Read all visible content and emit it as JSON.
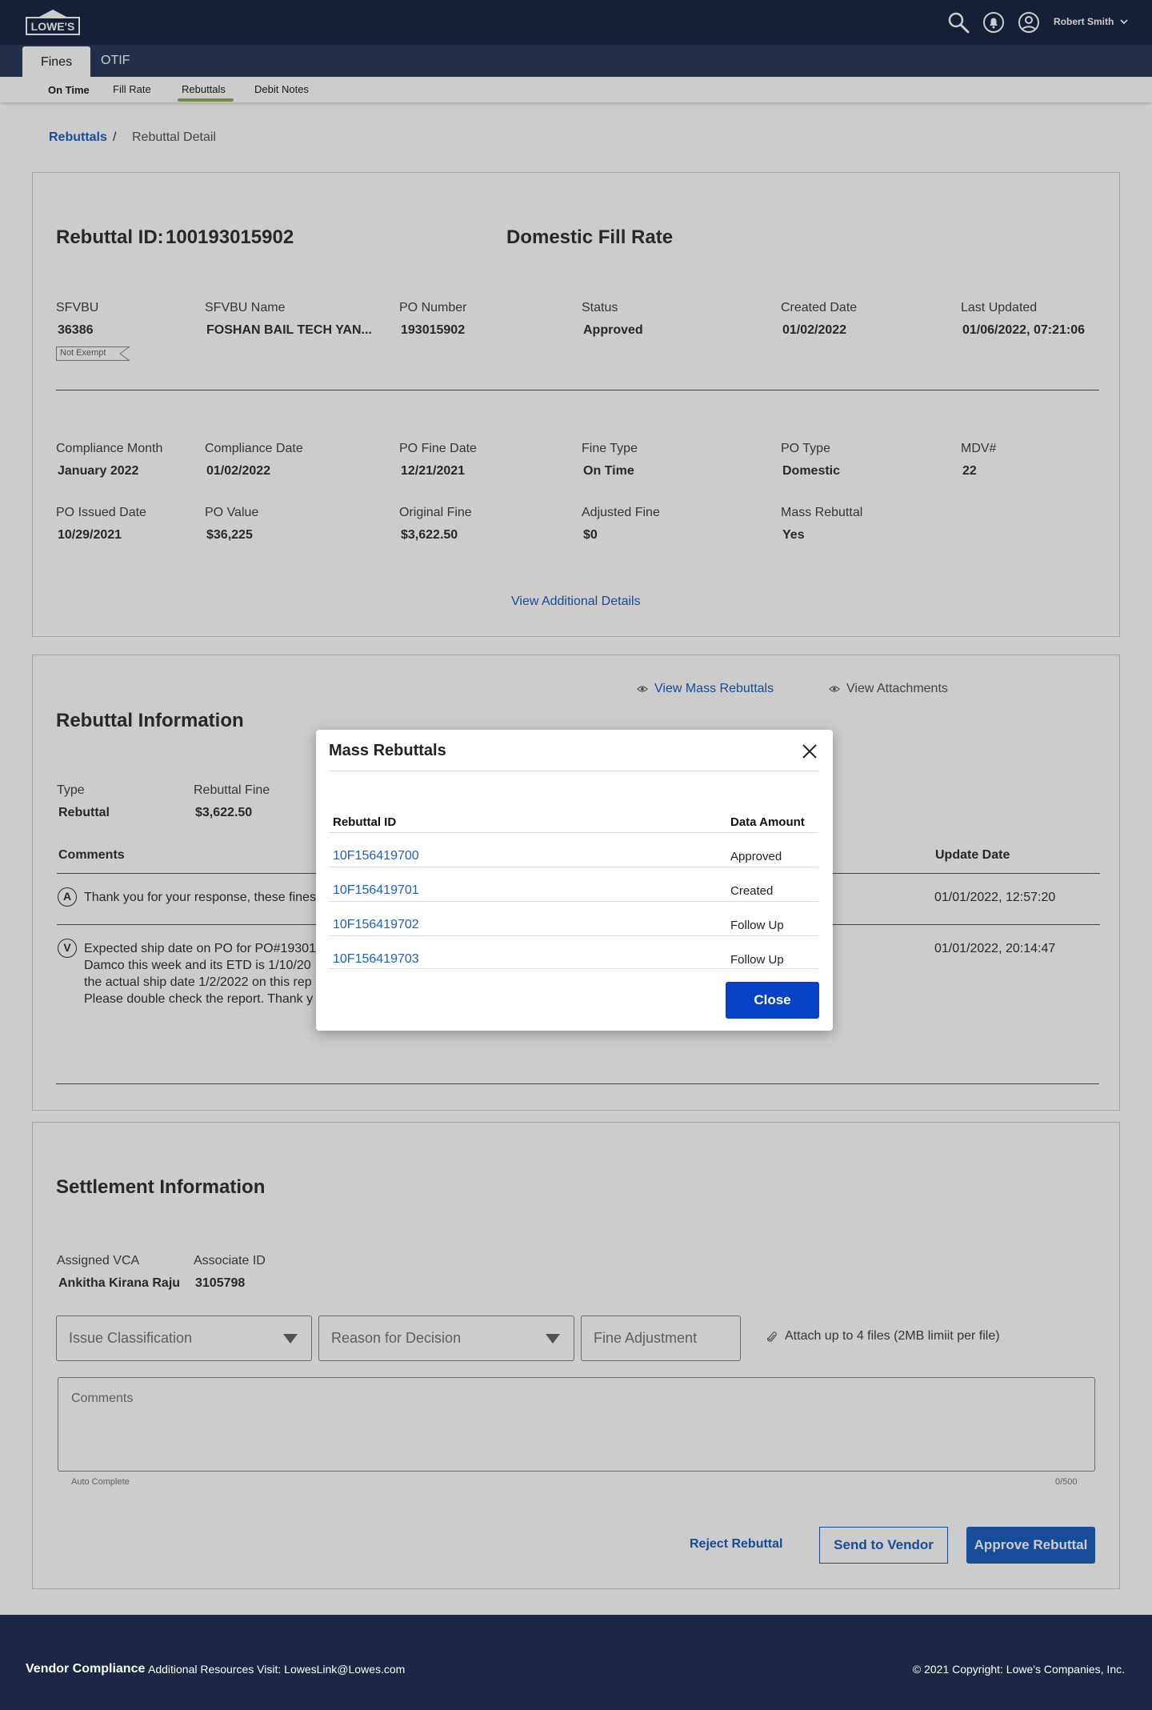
{
  "header": {
    "logo_text": "LOWE'S",
    "user_name": "Robert Smith"
  },
  "tabs": [
    {
      "label": "Fines"
    },
    {
      "label": "OTIF"
    }
  ],
  "subnav": [
    {
      "label": "On Time"
    },
    {
      "label": "Fill Rate"
    },
    {
      "label": "Rebuttals"
    },
    {
      "label": "Debit Notes"
    }
  ],
  "breadcrumb": {
    "link": "Rebuttals",
    "separator": "/",
    "current": "Rebuttal Detail"
  },
  "summary": {
    "rebuttal_id_label": "Rebuttal ID:",
    "rebuttal_id": "100193015902",
    "title": "Domestic Fill Rate",
    "exempt_badge": "Not Exempt",
    "row1": [
      {
        "label": "SFVBU",
        "value": "36386"
      },
      {
        "label": "SFVBU Name",
        "value": "FOSHAN BAIL TECH YAN..."
      },
      {
        "label": "PO Number",
        "value": "193015902"
      },
      {
        "label": "Status",
        "value": "Approved"
      },
      {
        "label": "Created Date",
        "value": "01/02/2022"
      },
      {
        "label": "Last Updated",
        "value": "01/06/2022, 07:21:06"
      }
    ],
    "row2": [
      {
        "label": "Compliance Month",
        "value": "January 2022"
      },
      {
        "label": "Compliance Date",
        "value": "01/02/2022"
      },
      {
        "label": "PO Fine Date",
        "value": "12/21/2021"
      },
      {
        "label": "Fine Type",
        "value": "On Time"
      },
      {
        "label": "PO Type",
        "value": "Domestic"
      },
      {
        "label": "MDV#",
        "value": "22"
      }
    ],
    "row3": [
      {
        "label": "PO Issued Date",
        "value": "10/29/2021"
      },
      {
        "label": "PO Value",
        "value": "$36,225"
      },
      {
        "label": "Original Fine",
        "value": "$3,622.50"
      },
      {
        "label": "Adjusted Fine",
        "value": "$0"
      },
      {
        "label": "Mass Rebuttal",
        "value": "Yes"
      }
    ],
    "view_details": "View Additional Details"
  },
  "rebuttal": {
    "title": "Rebuttal Information",
    "view_mass": "View Mass Rebuttals",
    "view_attachments": "View Attachments",
    "fields": [
      {
        "label": "Type",
        "value": "Rebuttal"
      },
      {
        "label": "Rebuttal Fine",
        "value": "$3,622.50"
      }
    ],
    "comments_header": "Comments",
    "update_header": "Update Date",
    "comments": [
      {
        "initial": "A",
        "lines": [
          "Thank you for your response, these fines"
        ],
        "date": "01/01/2022, 12:57:20"
      },
      {
        "initial": "V",
        "lines": [
          "Expected ship date on PO for PO#193015",
          "Damco this week and its ETD  is 1/10/20",
          "the actual ship date 1/2/2022 on this rep",
          "Please double check the report.  Thank y"
        ],
        "date": "01/01/2022, 20:14:47"
      }
    ]
  },
  "settlement": {
    "title": "Settlement Information",
    "fields": [
      {
        "label": "Assigned VCA",
        "value": "Ankitha Kirana Raju"
      },
      {
        "label": "Associate ID",
        "value": "3105798"
      }
    ],
    "issue_placeholder": "Issue Classification",
    "reason_placeholder": "Reason for Decision",
    "fine_placeholder": "Fine Adjustment",
    "attach_text": "Attach up to 4 files (2MB limiit per file)",
    "comments_placeholder": "Comments",
    "auto_complete": "Auto Complete",
    "char_count": "0/500",
    "reject": "Reject Rebuttal",
    "send": "Send to Vendor",
    "approve": "Approve Rebuttal"
  },
  "modal": {
    "title": "Mass Rebuttals",
    "col_id": "Rebuttal ID",
    "col_amount": "Data Amount",
    "rows": [
      {
        "id": "10F156419700",
        "status": "Approved"
      },
      {
        "id": "10F156419701",
        "status": "Created"
      },
      {
        "id": "10F156419702",
        "status": "Follow Up"
      },
      {
        "id": "10F156419703",
        "status": "Follow Up"
      }
    ],
    "close": "Close"
  },
  "footer": {
    "title": "Vendor Compliance",
    "resources": "Additional Resources Visit: LowesLink@Lowes.com",
    "copyright": "© 2021 Copyright: Lowe's Companies, Inc."
  }
}
